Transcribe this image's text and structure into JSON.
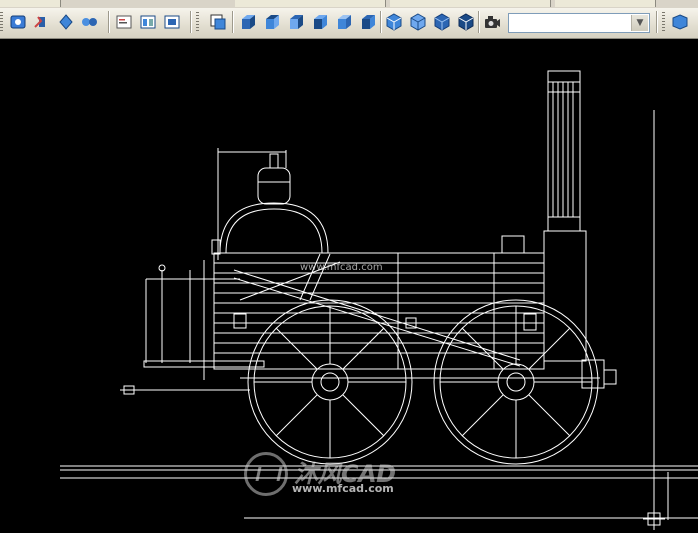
{
  "toolbar": {
    "buttons": [
      {
        "name": "orbit-icon"
      },
      {
        "name": "pan-icon"
      },
      {
        "name": "zoom-extents-icon"
      },
      {
        "name": "viewpoint-icon"
      },
      {
        "name": "properties-icon"
      },
      {
        "name": "design-center-icon"
      },
      {
        "name": "tool-palette-icon"
      },
      {
        "name": "named-views-icon"
      },
      {
        "name": "top-view-icon"
      },
      {
        "name": "bottom-view-icon"
      },
      {
        "name": "left-view-icon"
      },
      {
        "name": "right-view-icon"
      },
      {
        "name": "front-view-icon"
      },
      {
        "name": "back-view-icon"
      },
      {
        "name": "sw-iso-view-icon"
      },
      {
        "name": "se-iso-view-icon"
      },
      {
        "name": "ne-iso-view-icon"
      },
      {
        "name": "nw-iso-view-icon"
      },
      {
        "name": "camera-icon"
      }
    ],
    "view_combo_value": ""
  },
  "watermark": {
    "brand": "沐风CAD",
    "url_bottom": "www.mfcad.com",
    "url_top": "www.mfcad.com"
  },
  "colors": {
    "canvas_background": "#000000",
    "drawing_lines": "#ffffff",
    "toolbar_background": "#ece9d8"
  }
}
